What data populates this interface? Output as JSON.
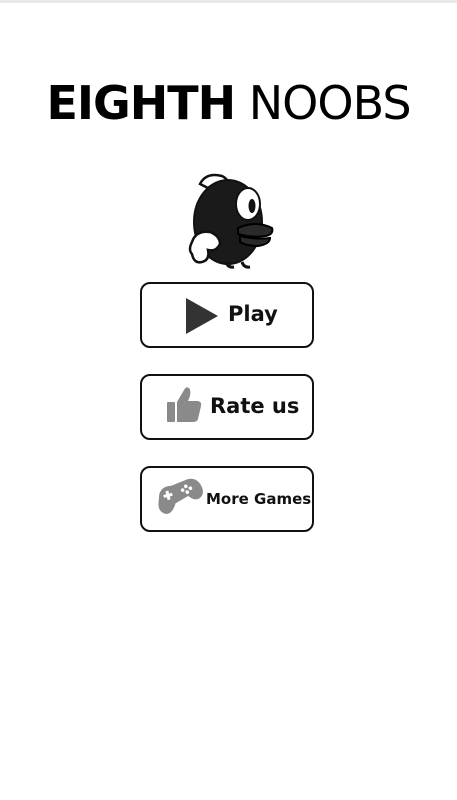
{
  "title": {
    "bold_part": "EIGHTH",
    "light_part": "NOOBS"
  },
  "mascot": {
    "icon": "bird-mascot"
  },
  "menu": {
    "play": {
      "label": "Play",
      "icon": "play-triangle-icon"
    },
    "rate": {
      "label": "Rate us",
      "icon": "thumbs-up-icon"
    },
    "more": {
      "label": "More Games",
      "icon": "gamepad-icon"
    }
  },
  "colors": {
    "background": "#ffffff",
    "text": "#111111",
    "icon_dark": "#333333",
    "icon_gray": "#8a8a8a"
  }
}
